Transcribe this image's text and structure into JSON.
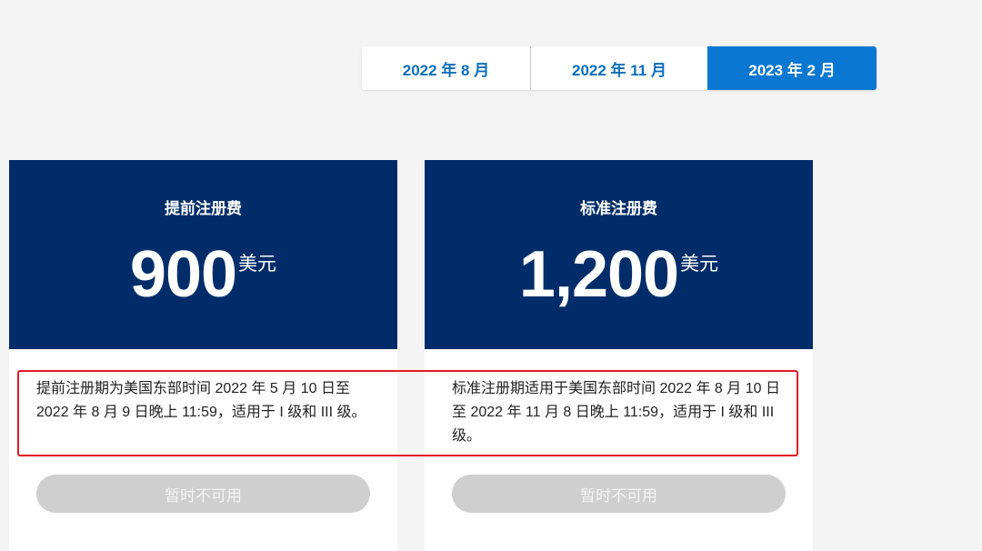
{
  "tabs": [
    {
      "label": "2022 年 8 月",
      "active": false
    },
    {
      "label": "2022 年 11 月",
      "active": false
    },
    {
      "label": "2023 年 2 月",
      "active": true
    }
  ],
  "cards": [
    {
      "title": "提前注册费",
      "amount": "900",
      "unit": "美元",
      "description": "提前注册期为美国东部时间 2022 年 5 月 10 日至 2022 年 8 月 9 日晚上 11:59，适用于 I 级和 III 级。",
      "button_label": "暂时不可用"
    },
    {
      "title": "标准注册费",
      "amount": "1,200",
      "unit": "美元",
      "description": "标准注册期适用于美国东部时间 2022 年 8 月 10 日至 2022 年 11 月 8 日晚上 11:59，适用于 I 级和 III 级。",
      "button_label": "暂时不可用"
    }
  ],
  "colors": {
    "card_header": "#002d6a",
    "tab_active": "#0a78d2",
    "tab_text": "#0a6ebd",
    "button_disabled": "#cfcfcf",
    "highlight": "#e31b23"
  }
}
